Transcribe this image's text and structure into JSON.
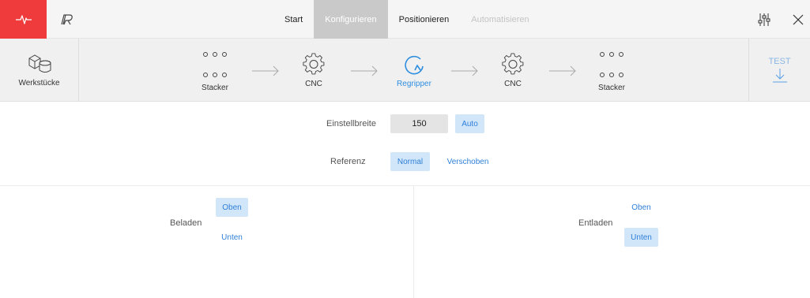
{
  "nav": {
    "start": "Start",
    "configure": "Konfigurieren",
    "position": "Positionieren",
    "automate": "Automatisieren"
  },
  "workpieces_label": "Werkstücke",
  "process": {
    "steps": [
      {
        "label": "Stacker",
        "icon": "stacker-icon"
      },
      {
        "label": "CNC",
        "icon": "gear-icon"
      },
      {
        "label": "Regripper",
        "icon": "regripper-icon"
      },
      {
        "label": "CNC",
        "icon": "gear-icon"
      },
      {
        "label": "Stacker",
        "icon": "stacker-icon"
      }
    ],
    "active_step": "Regripper"
  },
  "test_label": "TEST",
  "settings": {
    "width_label": "Einstellbreite",
    "width_value": "150",
    "auto_label": "Auto",
    "reference_label": "Referenz",
    "reference_options": [
      "Normal",
      "Verschoben"
    ],
    "reference_selected": "Normal"
  },
  "load": {
    "label": "Beladen",
    "options": [
      "Oben",
      "Unten"
    ],
    "selected": "Oben"
  },
  "unload": {
    "label": "Entladen",
    "options": [
      "Oben",
      "Unten"
    ],
    "selected": "Unten"
  },
  "colors": {
    "brand_red": "#ef3b3b",
    "accent_blue": "#2e8ee0",
    "selected_bg": "#d2e6fa"
  }
}
